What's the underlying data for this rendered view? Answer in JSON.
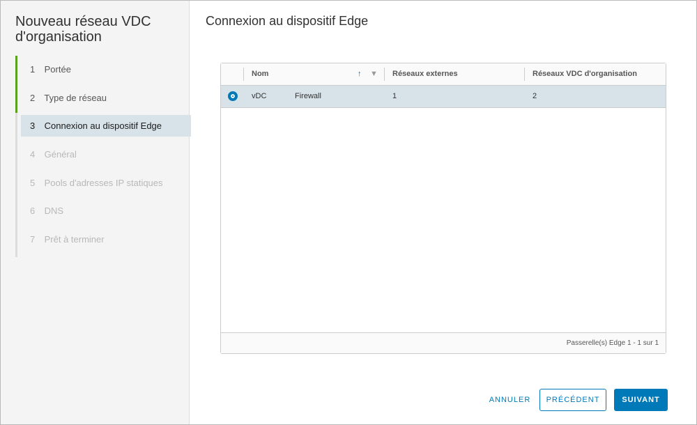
{
  "wizard": {
    "title": "Nouveau réseau VDC d'organisation",
    "steps": [
      {
        "num": "1",
        "label": "Portée",
        "state": "done"
      },
      {
        "num": "2",
        "label": "Type de réseau",
        "state": "done"
      },
      {
        "num": "3",
        "label": "Connexion au dispositif Edge",
        "state": "active"
      },
      {
        "num": "4",
        "label": "Général",
        "state": "disabled"
      },
      {
        "num": "5",
        "label": "Pools d'adresses IP statiques",
        "state": "disabled"
      },
      {
        "num": "6",
        "label": "DNS",
        "state": "disabled"
      },
      {
        "num": "7",
        "label": "Prêt à terminer",
        "state": "disabled"
      }
    ]
  },
  "main": {
    "title": "Connexion au dispositif Edge"
  },
  "grid": {
    "columns": [
      "Nom",
      "Réseaux externes",
      "Réseaux VDC d'organisation"
    ],
    "sort_icon": "sort-ascending-icon",
    "filter_icon": "filter-icon",
    "rows": [
      {
        "selected": true,
        "name_prefix": "vDC",
        "name": "Firewall",
        "external": "1",
        "org_vdc": "2"
      }
    ],
    "footer": "Passerelle(s) Edge 1 - 1 sur 1"
  },
  "buttons": {
    "cancel": "ANNULER",
    "previous": "PRÉCÉDENT",
    "next": "SUIVANT"
  },
  "colors": {
    "accent": "#0079b8",
    "step_done": "#5aa220",
    "selection": "#d8e3e9"
  }
}
